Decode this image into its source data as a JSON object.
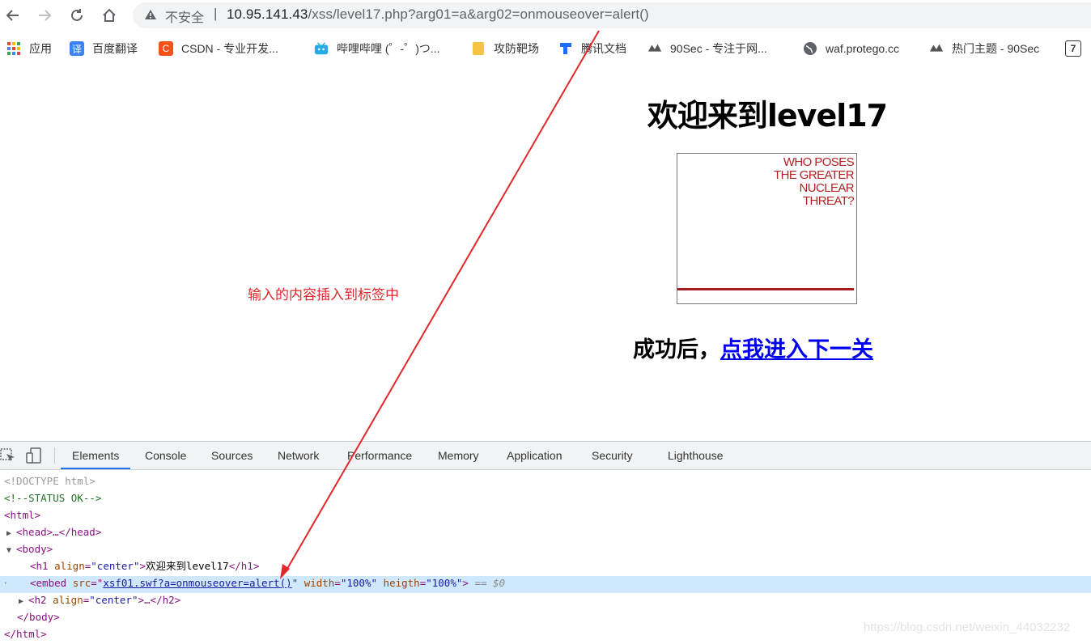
{
  "browser": {
    "security_label": "不安全",
    "separator": "|",
    "url_host": "10.95.141.43",
    "url_path": "/xss/level17.php?arg01=a&arg02=onmouseover=alert()"
  },
  "bookmarks": [
    {
      "label": "应用",
      "icon": "apps-grid-icon",
      "color": "#4285f4"
    },
    {
      "label": "百度翻译",
      "icon": "translate-icon",
      "color": "#3b82f6",
      "glyph": "译"
    },
    {
      "label": "CSDN - 专业开发...",
      "icon": "csdn-icon",
      "color": "#f4511e",
      "glyph": "C"
    },
    {
      "label": "哔哩哔哩 (゜-゜)つ...",
      "icon": "bilibili-icon",
      "color": "#23ade5"
    },
    {
      "label": "攻防靶场",
      "icon": "folder-icon",
      "color": "#f6c343"
    },
    {
      "label": "腾讯文档",
      "icon": "tencent-docs-icon",
      "color": "#1e6fff"
    },
    {
      "label": "90Sec - 专注于网...",
      "icon": "90sec-icon",
      "color": "#555555"
    },
    {
      "label": "waf.protego.cc",
      "icon": "globe-icon",
      "color": "#5f6368"
    },
    {
      "label": "热门主题 - 90Sec",
      "icon": "90sec-icon",
      "color": "#555555"
    },
    {
      "label": "",
      "icon": "seven-icon",
      "color": "#333333",
      "glyph": "7"
    }
  ],
  "page": {
    "heading": "欢迎来到level17",
    "embed_text": "WHO POSES\nTHE GREATER\nNUCLEAR\nTHREAT?",
    "success_prefix": "成功后，",
    "next_link": "点我进入下一关",
    "annotation": "输入的内容插入到标签中",
    "accent_color": "#e0282b"
  },
  "devtools": {
    "tabs": [
      "Elements",
      "Console",
      "Sources",
      "Network",
      "Performance",
      "Memory",
      "Application",
      "Security",
      "Lighthouse"
    ],
    "active_tab": "Elements",
    "lines": {
      "doctype": "<!DOCTYPE html>",
      "comment": "<!--STATUS OK-->",
      "html_open": "<html>",
      "head": "<head>…</head>",
      "body_open": "<body>",
      "h1_tag_open": "<h1",
      "h1_attr": "align",
      "h1_val": "\"center\"",
      "h1_text": "欢迎来到level17",
      "h1_close": "</h1>",
      "embed_tag": "<embed",
      "embed_src_attr": "src",
      "embed_src_val": "xsf01.swf?a=onmouseover=alert()",
      "embed_width_attr": "width",
      "embed_width_val": "\"100%\"",
      "embed_heigth_attr": "heigth",
      "embed_heigth_val": "\"100%\"",
      "embed_end": ">",
      "embed_marker": "== $0",
      "h2_tag_open": "<h2",
      "h2_attr": "align",
      "h2_val": "\"center\"",
      "h2_rest": ">…</h2>",
      "body_close": "</body>",
      "html_close": "</html>"
    }
  },
  "watermark": "https://blog.csdn.net/weixin_44032232"
}
